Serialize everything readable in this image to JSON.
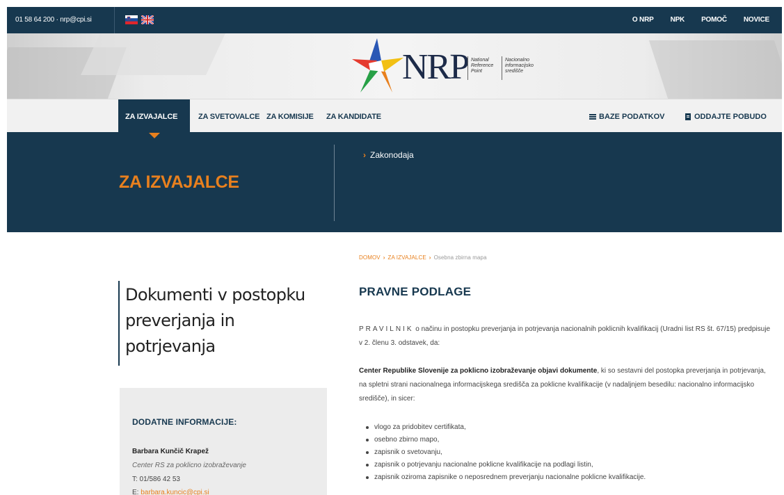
{
  "topbar": {
    "contact": "01 58 64 200  ·  nrp@cpi.si",
    "nav": [
      "O NRP",
      "NPK",
      "POMOČ",
      "NOVICE"
    ]
  },
  "logo": {
    "title": "NRP",
    "sub_en": [
      "National",
      "Reference",
      "Point"
    ],
    "sub_si": [
      "Nacionalno",
      "informacijsko",
      "središče"
    ]
  },
  "mainnav": {
    "items": [
      "ZA IZVAJALCE",
      "ZA SVETOVALCE",
      "ZA KOMISIJE",
      "ZA KANDIDATE"
    ],
    "right": [
      "BAZE PODATKOV",
      "ODDAJTE POBUDO"
    ]
  },
  "hero": {
    "title": "ZA IZVAJALCE",
    "sublink": "Zakonodaja"
  },
  "breadcrumb": {
    "home": "DOMOV",
    "section": "ZA IZVAJALCE",
    "current": "Osebna zbirna mapa"
  },
  "sidebar": {
    "title_lines": [
      "Dokumenti v postopku",
      "preverjanja in",
      "potrjevanja"
    ],
    "info_heading": "DODATNE INFORMACIJE:",
    "contact_name": "Barbara Kunčič Krapež",
    "contact_org": "Center RS za poklicno izobraževanje",
    "contact_phone": "T: 01/586 42 53",
    "contact_email_label": "E: ",
    "contact_email": "barbara.kuncic@cpi.si"
  },
  "content": {
    "heading": "PRAVNE PODLAGE",
    "para1_spaced": "PRAVILNIK",
    "para1_rest": " o načinu in postopku preverjanja in potrjevanja nacionalnih poklicnih kvalifikacij (Uradni list RS št. 67/15) predpisuje v 2. členu 3. odstavek, da:",
    "para2_bold": "Center Republike Slovenije za poklicno izobraževanje objavi dokumente",
    "para2_rest": ", ki so sestavni del postopka preverjanja in potrjevanja, na spletni strani nacionalnega informacijskega središča za poklicne kvalifikacije (v nadaljnjem besedilu: nacionalno informacijsko središče), in sicer:",
    "list": [
      "vlogo za pridobitev certifikata,",
      "osebno zbirno mapo,",
      "zapisnik o svetovanju,",
      "zapisnik o potrjevanju nacionalne poklicne kvalifikacije na podlagi listin,",
      "zapisnik oziroma zapisnike o neposrednem preverjanju nacionalne poklicne kvalifikacije."
    ]
  },
  "colors": {
    "navy": "#17384f",
    "accent": "#e8801e"
  }
}
